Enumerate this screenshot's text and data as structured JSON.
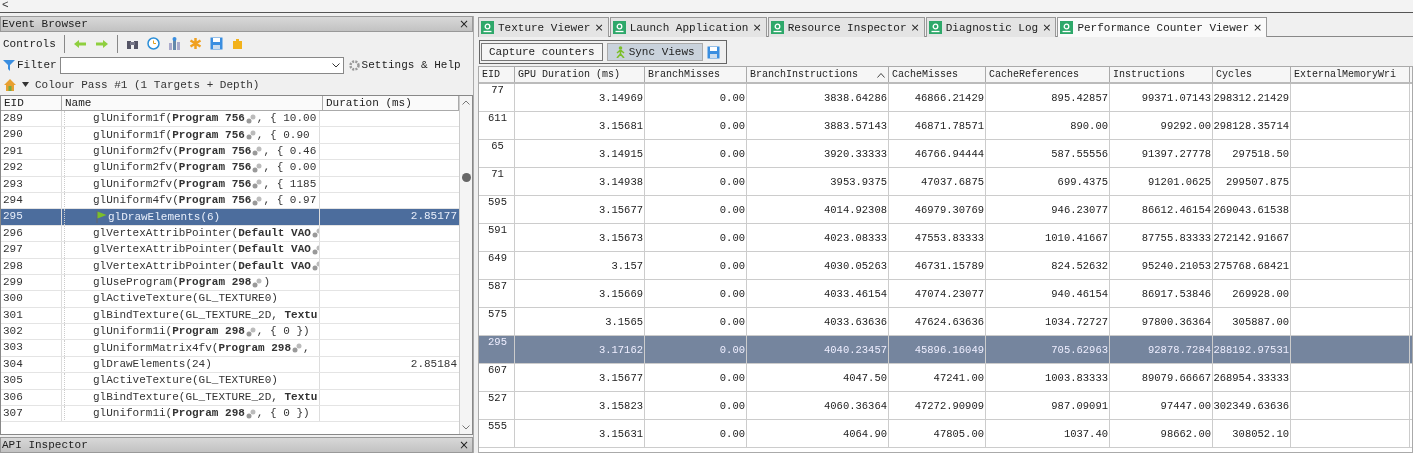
{
  "top_bar": {
    "back": "<"
  },
  "event_browser": {
    "title": "Event Browser",
    "close": "×",
    "controls_label": "Controls",
    "filter_label": "Filter",
    "settings": "Settings & Help",
    "breadcrumb": "Colour Pass #1 (1 Targets + Depth)",
    "columns": [
      "EID",
      "Name",
      "Duration (ms)"
    ],
    "rows": [
      {
        "eid": "289",
        "call": "glUniform1f(**Program 756**",
        "link": true,
        "tail": ", { 10.00",
        "duration": "",
        "selected": false,
        "flag": false
      },
      {
        "eid": "290",
        "call": "glUniform1f(**Program 756**",
        "link": true,
        "tail": ", { 0.90",
        "duration": "",
        "selected": false,
        "flag": false
      },
      {
        "eid": "291",
        "call": "glUniform2fv(**Program 756**",
        "link": true,
        "tail": ", { 0.46",
        "duration": "",
        "selected": false,
        "flag": false
      },
      {
        "eid": "292",
        "call": "glUniform2fv(**Program 756**",
        "link": true,
        "tail": ", { 0.00",
        "duration": "",
        "selected": false,
        "flag": false
      },
      {
        "eid": "293",
        "call": "glUniform2fv(**Program 756**",
        "link": true,
        "tail": ", { 1185",
        "duration": "",
        "selected": false,
        "flag": false
      },
      {
        "eid": "294",
        "call": "glUniform4fv(**Program 756**",
        "link": true,
        "tail": ", { 0.97",
        "duration": "",
        "selected": false,
        "flag": false
      },
      {
        "eid": "295",
        "call": "glDrawElements(6)",
        "link": false,
        "tail": "",
        "duration": "2.85177",
        "selected": true,
        "flag": true
      },
      {
        "eid": "296",
        "call": "glVertexAttribPointer(**Default VAO**",
        "link": true,
        "tail": "",
        "duration": "",
        "selected": false,
        "flag": false
      },
      {
        "eid": "297",
        "call": "glVertexAttribPointer(**Default VAO**",
        "link": true,
        "tail": "",
        "duration": "",
        "selected": false,
        "flag": false
      },
      {
        "eid": "298",
        "call": "glVertexAttribPointer(**Default VAO**",
        "link": true,
        "tail": "",
        "duration": "",
        "selected": false,
        "flag": false
      },
      {
        "eid": "299",
        "call": "glUseProgram(**Program 298**",
        "link": true,
        "tail": ")",
        "duration": "",
        "selected": false,
        "flag": false
      },
      {
        "eid": "300",
        "call": "glActiveTexture(GL_TEXTURE0)",
        "link": false,
        "tail": "",
        "duration": "",
        "selected": false,
        "flag": false
      },
      {
        "eid": "301",
        "call": "glBindTexture(GL_TEXTURE_2D, **Textu**",
        "link": false,
        "tail": "",
        "duration": "",
        "selected": false,
        "flag": false
      },
      {
        "eid": "302",
        "call": "glUniform1i(**Program 298**",
        "link": true,
        "tail": ", { 0 })",
        "duration": "",
        "selected": false,
        "flag": false
      },
      {
        "eid": "303",
        "call": "glUniformMatrix4fv(**Program 298**",
        "link": true,
        "tail": ",",
        "duration": "",
        "selected": false,
        "flag": false
      },
      {
        "eid": "304",
        "call": "glDrawElements(24)",
        "link": false,
        "tail": "",
        "duration": "2.85184",
        "selected": false,
        "flag": false
      },
      {
        "eid": "305",
        "call": "glActiveTexture(GL_TEXTURE0)",
        "link": false,
        "tail": "",
        "duration": "",
        "selected": false,
        "flag": false
      },
      {
        "eid": "306",
        "call": "glBindTexture(GL_TEXTURE_2D, **Textu**",
        "link": false,
        "tail": "",
        "duration": "",
        "selected": false,
        "flag": false
      },
      {
        "eid": "307",
        "call": "glUniform1i(**Program 298**",
        "link": true,
        "tail": ", { 0 })",
        "duration": "",
        "selected": false,
        "flag": false
      }
    ]
  },
  "api_inspector": {
    "title": "API Inspector",
    "close": "×"
  },
  "tabs": [
    {
      "label": "Texture Viewer",
      "selected": false
    },
    {
      "label": "Launch Application",
      "selected": false
    },
    {
      "label": "Resource Inspector",
      "selected": false
    },
    {
      "label": "Diagnostic Log",
      "selected": false
    },
    {
      "label": "Performance Counter Viewer",
      "selected": true
    }
  ],
  "tab_close": "×",
  "counter_toolbar": {
    "capture": "Capture counters",
    "sync": "Sync Views",
    "sync_on": true
  },
  "counters": {
    "columns": [
      {
        "label": "EID",
        "sorted": false
      },
      {
        "label": "GPU Duration (ms)",
        "sorted": false
      },
      {
        "label": "BranchMisses",
        "sorted": false
      },
      {
        "label": "BranchInstructions",
        "sorted": true
      },
      {
        "label": "CacheMisses",
        "sorted": false
      },
      {
        "label": "CacheReferences",
        "sorted": false
      },
      {
        "label": "Instructions",
        "sorted": false
      },
      {
        "label": "Cycles",
        "sorted": false
      },
      {
        "label": "ExternalMemoryWri",
        "sorted": false
      }
    ],
    "rows": [
      {
        "selected": false,
        "cells": [
          "77",
          "3.14969",
          "0.00",
          "3838.64286",
          "46866.21429",
          "895.42857",
          "99371.07143",
          "298312.21429"
        ]
      },
      {
        "selected": false,
        "cells": [
          "611",
          "3.15681",
          "0.00",
          "3883.57143",
          "46871.78571",
          "890.00",
          "99292.00",
          "298128.35714"
        ]
      },
      {
        "selected": false,
        "cells": [
          "65",
          "3.14915",
          "0.00",
          "3920.33333",
          "46766.94444",
          "587.55556",
          "91397.27778",
          "297518.50"
        ]
      },
      {
        "selected": false,
        "cells": [
          "71",
          "3.14938",
          "0.00",
          "3953.9375",
          "47037.6875",
          "699.4375",
          "91201.0625",
          "299507.875"
        ]
      },
      {
        "selected": false,
        "cells": [
          "595",
          "3.15677",
          "0.00",
          "4014.92308",
          "46979.30769",
          "946.23077",
          "86612.46154",
          "269043.61538"
        ]
      },
      {
        "selected": false,
        "cells": [
          "591",
          "3.15673",
          "0.00",
          "4023.08333",
          "47553.83333",
          "1010.41667",
          "87755.83333",
          "272142.91667"
        ]
      },
      {
        "selected": false,
        "cells": [
          "649",
          "3.157",
          "0.00",
          "4030.05263",
          "46731.15789",
          "824.52632",
          "95240.21053",
          "275768.68421"
        ]
      },
      {
        "selected": false,
        "cells": [
          "587",
          "3.15669",
          "0.00",
          "4033.46154",
          "47074.23077",
          "940.46154",
          "86917.53846",
          "269928.00"
        ]
      },
      {
        "selected": false,
        "cells": [
          "575",
          "3.1565",
          "0.00",
          "4033.63636",
          "47624.63636",
          "1034.72727",
          "97800.36364",
          "305887.00"
        ]
      },
      {
        "selected": true,
        "cells": [
          "295",
          "3.17162",
          "0.00",
          "4040.23457",
          "45896.16049",
          "705.62963",
          "92878.7284",
          "288192.97531"
        ]
      },
      {
        "selected": false,
        "cells": [
          "607",
          "3.15677",
          "0.00",
          "4047.50",
          "47241.00",
          "1003.83333",
          "89079.66667",
          "268954.33333"
        ]
      },
      {
        "selected": false,
        "cells": [
          "527",
          "3.15823",
          "0.00",
          "4060.36364",
          "47272.90909",
          "987.09091",
          "97447.00",
          "302349.63636"
        ]
      },
      {
        "selected": false,
        "cells": [
          "555",
          "3.15631",
          "0.00",
          "4064.90",
          "47805.00",
          "1037.40",
          "98662.00",
          "308052.10"
        ]
      }
    ]
  }
}
